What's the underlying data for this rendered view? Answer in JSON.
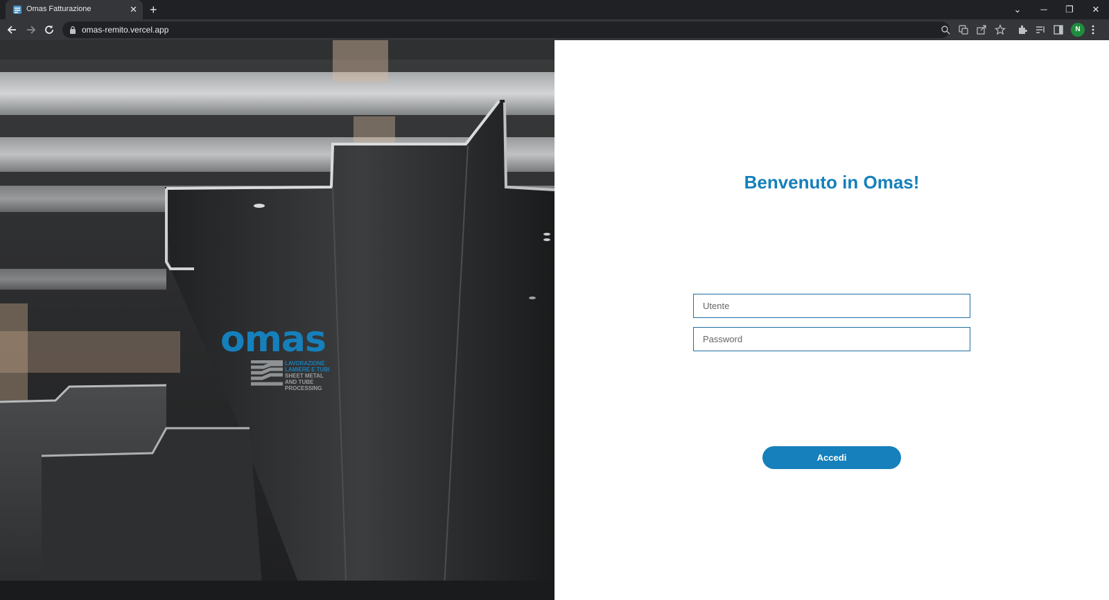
{
  "browser": {
    "tab_title": "Omas Fatturazione",
    "tab_close": "✕",
    "new_tab": "+",
    "url": "omas-remito.vercel.app",
    "window_controls": {
      "chevron": "⌄",
      "minimize": "─",
      "restore": "❐",
      "close": "✕"
    },
    "profile_initial": "N"
  },
  "hero": {
    "logo_text": "omas",
    "tagline": [
      "LAVORAZIONE",
      "LAMIERE E TUBI",
      "SHEET METAL",
      "AND TUBE",
      "PROCESSING"
    ]
  },
  "login": {
    "heading": "Benvenuto in Omas!",
    "username_placeholder": "Utente",
    "password_placeholder": "Password",
    "submit_label": "Accedi"
  },
  "colors": {
    "brand": "#1580bb",
    "chrome_dark": "#202124",
    "chrome_mid": "#35363a"
  }
}
